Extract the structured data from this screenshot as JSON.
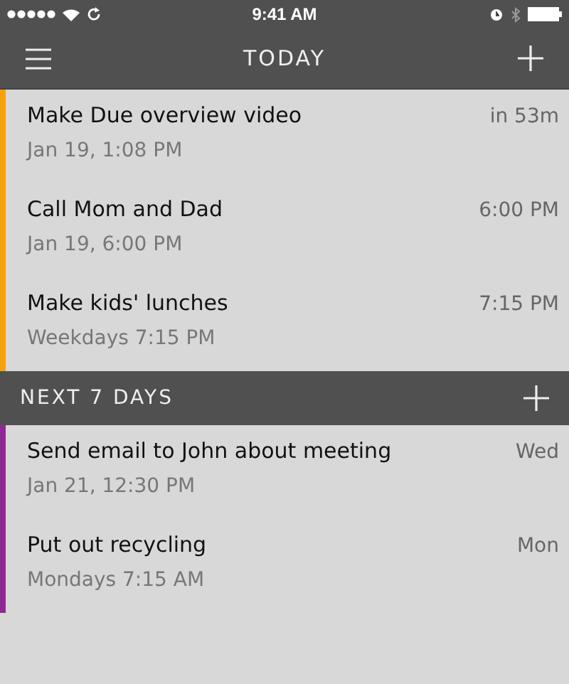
{
  "status_bar": {
    "time": "9:41 AM"
  },
  "nav_bar": {
    "title": "TODAY"
  },
  "sections": [
    {
      "color": "#f5a20a",
      "tasks": [
        {
          "title": "Make Due overview video",
          "due": "in 53m",
          "detail": "Jan 19, 1:08 PM"
        },
        {
          "title": "Call Mom and Dad",
          "due": "6:00 PM",
          "detail": "Jan 19, 6:00 PM"
        },
        {
          "title": "Make kids' lunches",
          "due": "7:15 PM",
          "detail": "Weekdays 7:15 PM"
        }
      ]
    },
    {
      "title": "NEXT 7 DAYS",
      "color": "#8e2a94",
      "tasks": [
        {
          "title": "Send email to John about meeting",
          "due": "Wed",
          "detail": "Jan 21, 12:30 PM"
        },
        {
          "title": "Put out recycling",
          "due": "Mon",
          "detail": "Mondays 7:15 AM"
        }
      ]
    }
  ]
}
